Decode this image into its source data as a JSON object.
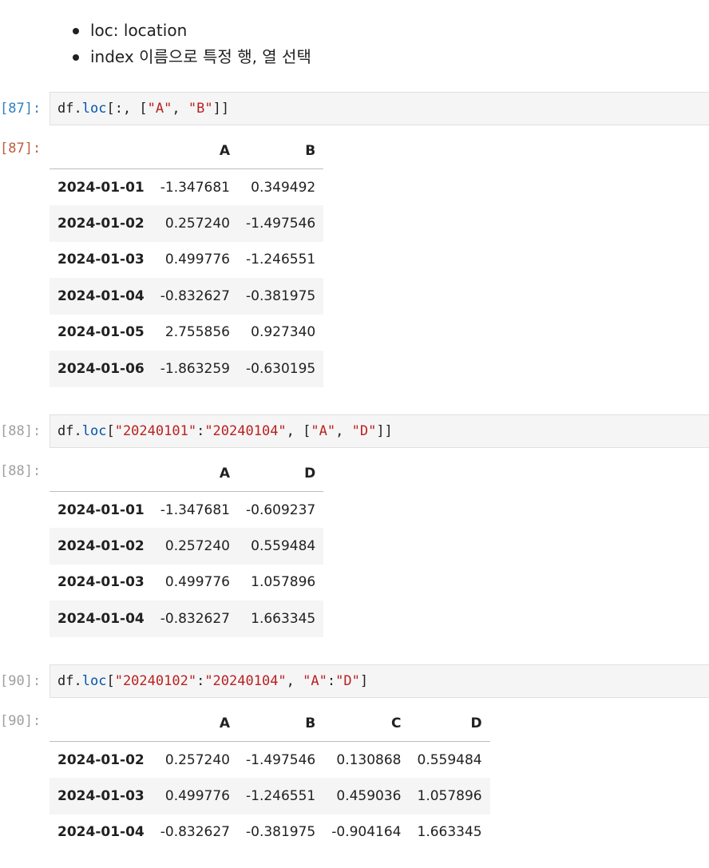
{
  "markdown": {
    "bullets": [
      "loc: location",
      "index 이름으로 특정 행, 열 선택"
    ]
  },
  "cells": [
    {
      "in_prompt": "[87]:",
      "out_prompt": "[87]:",
      "code_tokens": [
        {
          "t": "df",
          "c": "tok-br"
        },
        {
          "t": ".",
          "c": "tok-br"
        },
        {
          "t": "loc",
          "c": "tok-kw"
        },
        {
          "t": "[:, ",
          "c": "tok-br"
        },
        {
          "t": "[",
          "c": "tok-br"
        },
        {
          "t": "\"A\"",
          "c": "tok-str"
        },
        {
          "t": ", ",
          "c": "tok-br"
        },
        {
          "t": "\"B\"",
          "c": "tok-str"
        },
        {
          "t": "]]",
          "c": "tok-br"
        }
      ],
      "columns": [
        "A",
        "B"
      ],
      "rows": [
        {
          "index": "2024-01-01",
          "values": [
            "-1.347681",
            "0.349492"
          ]
        },
        {
          "index": "2024-01-02",
          "values": [
            "0.257240",
            "-1.497546"
          ]
        },
        {
          "index": "2024-01-03",
          "values": [
            "0.499776",
            "-1.246551"
          ]
        },
        {
          "index": "2024-01-04",
          "values": [
            "-0.832627",
            "-0.381975"
          ]
        },
        {
          "index": "2024-01-05",
          "values": [
            "2.755856",
            "0.927340"
          ]
        },
        {
          "index": "2024-01-06",
          "values": [
            "-1.863259",
            "-0.630195"
          ]
        }
      ]
    },
    {
      "in_prompt": "[88]:",
      "out_prompt": "[88]:",
      "code_tokens": [
        {
          "t": "df",
          "c": "tok-br"
        },
        {
          "t": ".",
          "c": "tok-br"
        },
        {
          "t": "loc",
          "c": "tok-kw"
        },
        {
          "t": "[",
          "c": "tok-br"
        },
        {
          "t": "\"20240101\"",
          "c": "tok-str"
        },
        {
          "t": ":",
          "c": "tok-br"
        },
        {
          "t": "\"20240104\"",
          "c": "tok-str"
        },
        {
          "t": ", [",
          "c": "tok-br"
        },
        {
          "t": "\"A\"",
          "c": "tok-str"
        },
        {
          "t": ", ",
          "c": "tok-br"
        },
        {
          "t": "\"D\"",
          "c": "tok-str"
        },
        {
          "t": "]]",
          "c": "tok-br"
        }
      ],
      "columns": [
        "A",
        "D"
      ],
      "rows": [
        {
          "index": "2024-01-01",
          "values": [
            "-1.347681",
            "-0.609237"
          ]
        },
        {
          "index": "2024-01-02",
          "values": [
            "0.257240",
            "0.559484"
          ]
        },
        {
          "index": "2024-01-03",
          "values": [
            "0.499776",
            "1.057896"
          ]
        },
        {
          "index": "2024-01-04",
          "values": [
            "-0.832627",
            "1.663345"
          ]
        }
      ]
    },
    {
      "in_prompt": "[90]:",
      "out_prompt": "[90]:",
      "code_tokens": [
        {
          "t": "df",
          "c": "tok-br"
        },
        {
          "t": ".",
          "c": "tok-br"
        },
        {
          "t": "loc",
          "c": "tok-kw"
        },
        {
          "t": "[",
          "c": "tok-br"
        },
        {
          "t": "\"20240102\"",
          "c": "tok-str"
        },
        {
          "t": ":",
          "c": "tok-br"
        },
        {
          "t": "\"20240104\"",
          "c": "tok-str"
        },
        {
          "t": ", ",
          "c": "tok-br"
        },
        {
          "t": "\"A\"",
          "c": "tok-str"
        },
        {
          "t": ":",
          "c": "tok-br"
        },
        {
          "t": "\"D\"",
          "c": "tok-str"
        },
        {
          "t": "]",
          "c": "tok-br"
        }
      ],
      "columns": [
        "A",
        "B",
        "C",
        "D"
      ],
      "rows": [
        {
          "index": "2024-01-02",
          "values": [
            "0.257240",
            "-1.497546",
            "0.130868",
            "0.559484"
          ]
        },
        {
          "index": "2024-01-03",
          "values": [
            "0.499776",
            "-1.246551",
            "0.459036",
            "1.057896"
          ]
        },
        {
          "index": "2024-01-04",
          "values": [
            "-0.832627",
            "-0.381975",
            "-0.904164",
            "1.663345"
          ]
        }
      ]
    }
  ]
}
